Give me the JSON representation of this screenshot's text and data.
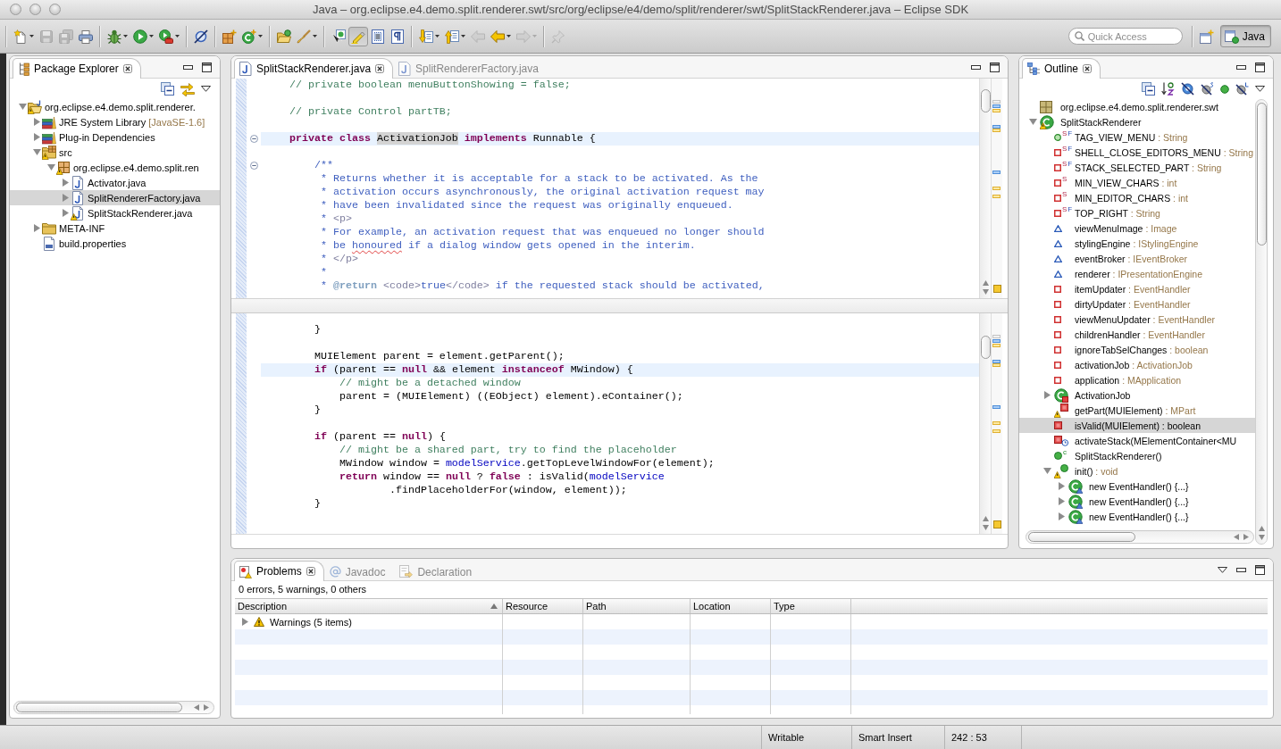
{
  "window": {
    "title": "Java – org.eclipse.e4.demo.split.renderer.swt/src/org/eclipse/e4/demo/split/renderer/swt/SplitStackRenderer.java – Eclipse SDK"
  },
  "toolbar": {
    "groups": [
      [
        {
          "disabled": false,
          "pressed": false,
          "menu": true
        },
        {
          "disabled": true,
          "pressed": false,
          "menu": false
        },
        {
          "disabled": true,
          "pressed": false,
          "menu": false
        },
        {
          "disabled": false,
          "pressed": false,
          "menu": false
        }
      ],
      [
        {
          "disabled": false,
          "pressed": false,
          "menu": true
        },
        {
          "disabled": false,
          "pressed": false,
          "menu": true
        },
        {
          "disabled": false,
          "pressed": false,
          "menu": true
        }
      ],
      [
        {
          "disabled": false,
          "pressed": false,
          "menu": false
        }
      ],
      [
        {
          "disabled": false,
          "pressed": false,
          "menu": false
        },
        {
          "disabled": false,
          "pressed": false,
          "menu": true
        }
      ],
      [
        {
          "disabled": false,
          "pressed": false,
          "menu": false
        },
        {
          "disabled": false,
          "pressed": false,
          "menu": true
        }
      ],
      [
        {
          "disabled": false,
          "pressed": false,
          "menu": false
        },
        {
          "disabled": false,
          "pressed": true,
          "menu": false
        },
        {
          "disabled": false,
          "pressed": false,
          "menu": false
        },
        {
          "disabled": false,
          "pressed": false,
          "menu": false
        }
      ],
      [
        {
          "disabled": false,
          "pressed": false,
          "menu": true
        },
        {
          "disabled": false,
          "pressed": false,
          "menu": true
        },
        {
          "disabled": true,
          "pressed": false,
          "menu": false
        },
        {
          "disabled": false,
          "pressed": false,
          "menu": true
        },
        {
          "disabled": true,
          "pressed": false,
          "menu": true
        }
      ],
      [
        {
          "disabled": true,
          "pressed": false,
          "menu": false
        }
      ]
    ],
    "quick_access": {
      "placeholder": "Quick Access"
    },
    "perspectives": [
      {
        "label": "Java",
        "selected": true
      }
    ]
  },
  "package_explorer": {
    "tab": {
      "label": "Package Explorer",
      "selected": true
    },
    "items": [
      {
        "label": "org.eclipse.e4.demo.split.renderer.",
        "kind": "project",
        "expanded": true,
        "warning": true,
        "selected": false,
        "children": [
          {
            "label": "JRE System Library",
            "decoration": "[JavaSE-1.6]",
            "kind": "library",
            "expanded": false,
            "warning": false,
            "selected": false
          },
          {
            "label": "Plug-in Dependencies",
            "kind": "library",
            "expanded": false,
            "warning": false,
            "selected": false
          },
          {
            "label": "src",
            "kind": "source-folder",
            "expanded": true,
            "warning": true,
            "selected": false,
            "children": [
              {
                "label": "org.eclipse.e4.demo.split.ren",
                "kind": "package",
                "expanded": true,
                "warning": true,
                "selected": false,
                "children": [
                  {
                    "label": "Activator.java",
                    "kind": "java-file",
                    "expanded": false,
                    "warning": false,
                    "selected": false
                  },
                  {
                    "label": "SplitRendererFactory.java",
                    "kind": "java-file",
                    "expanded": false,
                    "warning": false,
                    "selected": true
                  },
                  {
                    "label": "SplitStackRenderer.java",
                    "kind": "java-file",
                    "expanded": false,
                    "warning": true,
                    "selected": false
                  }
                ]
              }
            ]
          },
          {
            "label": "META-INF",
            "kind": "folder",
            "expanded": false,
            "warning": false,
            "selected": false
          },
          {
            "label": "build.properties",
            "kind": "properties-file",
            "warning": false,
            "selected": false
          }
        ]
      }
    ]
  },
  "editor": {
    "tabs": [
      {
        "label": "SplitStackRenderer.java",
        "selected": true
      },
      {
        "label": "SplitRendererFactory.java",
        "selected": false
      }
    ],
    "panes": [
      {
        "warnings": true,
        "markers": [
          {
            "kind": "annotation"
          },
          {
            "kind": "occurrence"
          },
          {
            "kind": "warning"
          },
          {
            "kind": "occurrence"
          },
          {
            "kind": "warning"
          },
          {
            "kind": "occurrence"
          },
          {
            "kind": "warning"
          },
          {
            "kind": "warning"
          }
        ],
        "blocks": [
          {
            "lines": [
              {
                "current": false,
                "tokens": [
                  {
                    "kind": "comment",
                    "text": "    // private boolean menuButtonShowing = false;"
                  }
                ]
              }
            ]
          },
          {
            "lines": [
              {
                "current": false,
                "tokens": [
                  {
                    "kind": "comment",
                    "text": "    // private Control partTB;"
                  }
                ]
              }
            ]
          },
          {
            "lines": [
              {
                "current": true,
                "expanded": true,
                "tokens": [
                  {
                    "kind": "keyword",
                    "text": "    private class "
                  },
                  {
                    "kind": "occurrence",
                    "text": "ActivationJob"
                  },
                  {
                    "kind": "keyword",
                    "text": " implements"
                  },
                  {
                    "kind": "plain",
                    "text": " Runnable {"
                  }
                ]
              }
            ]
          },
          {
            "lines": [
              {
                "current": false,
                "expanded": true,
                "tokens": [
                  {
                    "kind": "doc",
                    "text": "        /**"
                  }
                ]
              },
              {
                "current": false,
                "tokens": [
                  {
                    "kind": "doc",
                    "text": "         * Returns whether it is acceptable for a stack to be activated. As the"
                  }
                ]
              },
              {
                "current": false,
                "tokens": [
                  {
                    "kind": "doc",
                    "text": "         * activation occurs asynchronously, the original activation request may"
                  }
                ]
              },
              {
                "current": false,
                "tokens": [
                  {
                    "kind": "doc",
                    "text": "         * have been invalidated since the request was originally enqueued."
                  }
                ]
              },
              {
                "current": false,
                "tokens": [
                  {
                    "kind": "doc",
                    "text": "         * "
                  },
                  {
                    "kind": "doc-html",
                    "text": "<p>"
                  }
                ]
              },
              {
                "current": false,
                "tokens": [
                  {
                    "kind": "doc",
                    "text": "         * For example, an activation request that was enqueued no longer should"
                  }
                ]
              },
              {
                "current": false,
                "tokens": [
                  {
                    "kind": "doc",
                    "text": "         * be "
                  },
                  {
                    "kind": "misspelled",
                    "text": "honoured"
                  },
                  {
                    "kind": "doc",
                    "text": " if a dialog window gets opened in the interim."
                  }
                ]
              },
              {
                "current": false,
                "tokens": [
                  {
                    "kind": "doc",
                    "text": "         * "
                  },
                  {
                    "kind": "doc-html",
                    "text": "</p>"
                  }
                ]
              },
              {
                "current": false,
                "tokens": [
                  {
                    "kind": "doc",
                    "text": "         *"
                  }
                ]
              },
              {
                "current": false,
                "tokens": [
                  {
                    "kind": "doc",
                    "text": "         * "
                  },
                  {
                    "kind": "doc-tag",
                    "text": "@return"
                  },
                  {
                    "kind": "doc-html",
                    "text": " <code>"
                  },
                  {
                    "kind": "doc",
                    "text": "true"
                  },
                  {
                    "kind": "doc-html",
                    "text": "</code>"
                  },
                  {
                    "kind": "doc",
                    "text": " if the requested stack should be activated,"
                  }
                ]
              }
            ]
          }
        ]
      },
      {
        "warnings": true,
        "markers": [
          {
            "kind": "annotation"
          },
          {
            "kind": "occurrence"
          },
          {
            "kind": "warning"
          },
          {
            "kind": "occurrence"
          },
          {
            "kind": "warning"
          },
          {
            "kind": "occurrence"
          },
          {
            "kind": "warning"
          },
          {
            "kind": "warning"
          }
        ],
        "blocks": [
          {
            "lines": [
              {
                "current": false,
                "tokens": [
                  {
                    "kind": "plain",
                    "text": "        }"
                  }
                ]
              }
            ]
          },
          {
            "lines": [
              {
                "current": false,
                "tokens": [
                  {
                    "kind": "plain",
                    "text": "        MUIElement parent = element.getParent();"
                  }
                ]
              },
              {
                "current": true,
                "tokens": [
                  {
                    "kind": "keyword",
                    "text": "        if"
                  },
                  {
                    "kind": "plain",
                    "text": " (parent == "
                  },
                  {
                    "kind": "keyword",
                    "text": "null"
                  },
                  {
                    "kind": "plain",
                    "text": " && element "
                  },
                  {
                    "kind": "keyword",
                    "text": "instanceof"
                  },
                  {
                    "kind": "plain",
                    "text": " MWindow) {"
                  }
                ]
              },
              {
                "current": false,
                "tokens": [
                  {
                    "kind": "comment",
                    "text": "            // might be a detached window"
                  }
                ]
              },
              {
                "current": false,
                "tokens": [
                  {
                    "kind": "plain",
                    "text": "            parent = (MUIElement) ((EObject) element).eContainer();"
                  }
                ]
              },
              {
                "current": false,
                "tokens": [
                  {
                    "kind": "plain",
                    "text": "        }"
                  }
                ]
              }
            ]
          },
          {
            "lines": [
              {
                "current": false,
                "tokens": [
                  {
                    "kind": "keyword",
                    "text": "        if"
                  },
                  {
                    "kind": "plain",
                    "text": " (parent == "
                  },
                  {
                    "kind": "keyword",
                    "text": "null"
                  },
                  {
                    "kind": "plain",
                    "text": ") {"
                  }
                ]
              },
              {
                "current": false,
                "tokens": [
                  {
                    "kind": "comment",
                    "text": "            // might be a shared part, try to find the placeholder"
                  }
                ]
              },
              {
                "current": false,
                "tokens": [
                  {
                    "kind": "plain",
                    "text": "            MWindow window = "
                  },
                  {
                    "kind": "field",
                    "text": "modelService"
                  },
                  {
                    "kind": "plain",
                    "text": ".getTopLevelWindowFor(element);"
                  }
                ]
              },
              {
                "current": false,
                "tokens": [
                  {
                    "kind": "keyword",
                    "text": "            return"
                  },
                  {
                    "kind": "plain",
                    "text": " window == "
                  },
                  {
                    "kind": "keyword",
                    "text": "null"
                  },
                  {
                    "kind": "plain",
                    "text": " ? "
                  },
                  {
                    "kind": "keyword",
                    "text": "false"
                  },
                  {
                    "kind": "plain",
                    "text": " : isValid("
                  },
                  {
                    "kind": "field",
                    "text": "modelService"
                  }
                ]
              },
              {
                "current": false,
                "tokens": [
                  {
                    "kind": "plain",
                    "text": "                    .findPlaceholderFor(window, element));"
                  }
                ]
              },
              {
                "current": false,
                "tokens": [
                  {
                    "kind": "plain",
                    "text": "        }"
                  }
                ]
              }
            ]
          }
        ]
      }
    ]
  },
  "outline": {
    "tab": {
      "label": "Outline",
      "selected": true
    },
    "items": [
      {
        "label": "org.eclipse.e4.demo.split.renderer.swt",
        "kind": "package",
        "warning": false,
        "selected": false
      },
      {
        "label": "SplitStackRenderer",
        "kind": "class",
        "expanded": true,
        "warning": true,
        "selected": false,
        "children": [
          {
            "label": "TAG_VIEW_MENU",
            "type": ": String",
            "kind": "public-field",
            "warning": false,
            "selected": false,
            "marks": [
              {
                "kind": "static",
                "text": "S"
              },
              {
                "kind": "final",
                "text": "F"
              }
            ]
          },
          {
            "label": "SHELL_CLOSE_EDITORS_MENU",
            "type": ": String",
            "kind": "private-field",
            "warning": false,
            "selected": false,
            "marks": [
              {
                "kind": "static",
                "text": "S"
              },
              {
                "kind": "final",
                "text": "F"
              }
            ]
          },
          {
            "label": "STACK_SELECTED_PART",
            "type": ": String",
            "kind": "private-field",
            "warning": false,
            "selected": false,
            "marks": [
              {
                "kind": "static",
                "text": "S"
              },
              {
                "kind": "final",
                "text": "F"
              }
            ]
          },
          {
            "label": "MIN_VIEW_CHARS",
            "type": ": int",
            "kind": "private-field",
            "warning": false,
            "selected": false,
            "marks": [
              {
                "kind": "static",
                "text": "S"
              }
            ]
          },
          {
            "label": "MIN_EDITOR_CHARS",
            "type": ": int",
            "kind": "private-field",
            "warning": false,
            "selected": false,
            "marks": [
              {
                "kind": "static",
                "text": "S"
              }
            ]
          },
          {
            "label": "TOP_RIGHT",
            "type": ": String",
            "kind": "private-field",
            "warning": false,
            "selected": false,
            "marks": [
              {
                "kind": "static",
                "text": "S"
              },
              {
                "kind": "final",
                "text": "F"
              }
            ]
          },
          {
            "label": "viewMenuImage",
            "type": ": Image",
            "kind": "default-field",
            "warning": false,
            "selected": false
          },
          {
            "label": "stylingEngine",
            "type": ": IStylingEngine",
            "kind": "default-field",
            "warning": false,
            "selected": false
          },
          {
            "label": "eventBroker",
            "type": ": IEventBroker",
            "kind": "default-field",
            "warning": false,
            "selected": false
          },
          {
            "label": "renderer",
            "type": ": IPresentationEngine",
            "kind": "default-field",
            "warning": false,
            "selected": false
          },
          {
            "label": "itemUpdater",
            "type": ": EventHandler",
            "kind": "private-field",
            "warning": false,
            "selected": false
          },
          {
            "label": "dirtyUpdater",
            "type": ": EventHandler",
            "kind": "private-field",
            "warning": false,
            "selected": false
          },
          {
            "label": "viewMenuUpdater",
            "type": ": EventHandler",
            "kind": "private-field",
            "warning": false,
            "selected": false
          },
          {
            "label": "childrenHandler",
            "type": ": EventHandler",
            "kind": "private-field",
            "warning": false,
            "selected": false
          },
          {
            "label": "ignoreTabSelChanges",
            "type": ": boolean",
            "kind": "private-field",
            "warning": false,
            "selected": false
          },
          {
            "label": "activationJob",
            "type": ": ActivationJob",
            "kind": "private-field",
            "warning": false,
            "selected": false
          },
          {
            "label": "application",
            "type": ": MApplication",
            "kind": "private-field",
            "warning": false,
            "selected": false
          },
          {
            "label": "ActivationJob",
            "kind": "inner-class",
            "expanded": false,
            "warning": false,
            "selected": false
          },
          {
            "label": "getPart(MUIElement)",
            "type": ": MPart",
            "kind": "private-method",
            "warning": true,
            "selected": false
          },
          {
            "label": "isValid(MUIElement)",
            "type": ": boolean",
            "kind": "private-method",
            "warning": false,
            "selected": true
          },
          {
            "label": "activateStack(MElementContainer<MU",
            "kind": "synchronized-method",
            "warning": false,
            "selected": false
          },
          {
            "label": "SplitStackRenderer()",
            "kind": "constructor",
            "warning": false,
            "selected": false,
            "marks": [
              {
                "kind": "constructor",
                "text": "c"
              }
            ]
          },
          {
            "label": "init()",
            "type": ": void",
            "kind": "public-method",
            "expanded": true,
            "warning": true,
            "selected": false,
            "children": [
              {
                "label": "new EventHandler() {...}",
                "kind": "anonymous-class",
                "expanded": false,
                "warning": false,
                "selected": false
              },
              {
                "label": "new EventHandler() {...}",
                "kind": "anonymous-class",
                "expanded": false,
                "warning": false,
                "selected": false
              },
              {
                "label": "new EventHandler() {...}",
                "kind": "anonymous-class",
                "expanded": false,
                "warning": false,
                "selected": false
              }
            ]
          }
        ]
      }
    ]
  },
  "problems": {
    "tabs": [
      {
        "label": "Problems",
        "kind": "problems",
        "selected": true
      },
      {
        "label": "Javadoc",
        "kind": "javadoc",
        "selected": false
      },
      {
        "label": "Declaration",
        "kind": "declaration",
        "selected": false
      }
    ],
    "summary": "0 errors, 5 warnings, 0 others",
    "columns": [
      {
        "label": "Description",
        "sorted": true
      },
      {
        "label": "Resource",
        "sorted": false
      },
      {
        "label": "Path",
        "sorted": false
      },
      {
        "label": "Location",
        "sorted": false
      },
      {
        "label": "Type",
        "sorted": false
      }
    ],
    "rows": [
      {
        "label": "Warnings (5 items)",
        "kind": "warning",
        "expanded": false
      }
    ]
  },
  "status_bar": {
    "fields": [
      "Writable",
      "Smart Insert",
      "242 : 53"
    ]
  }
}
